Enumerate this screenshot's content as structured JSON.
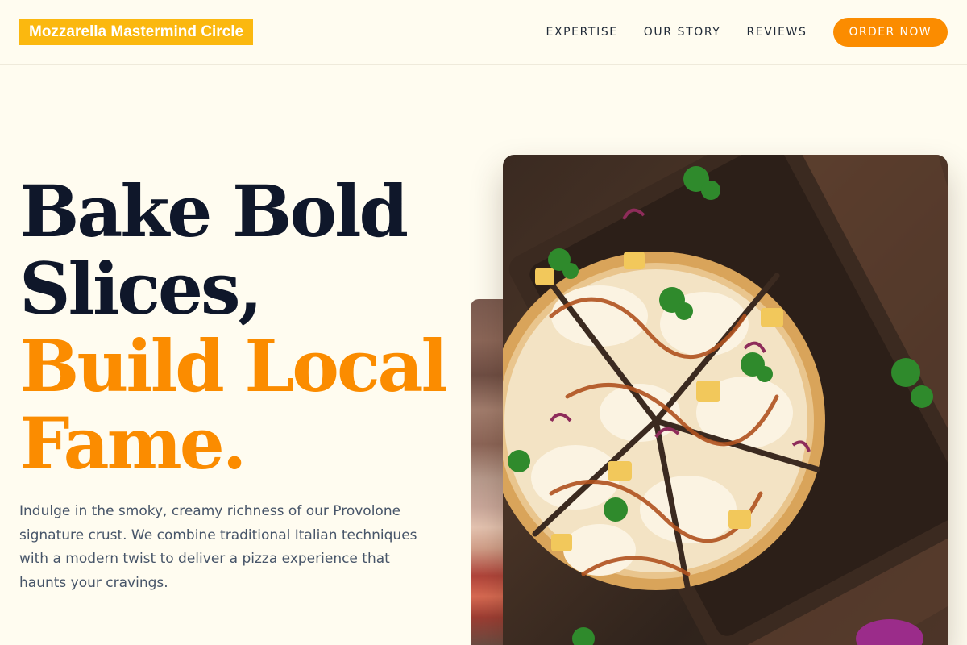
{
  "brand": {
    "name": "Mozzarella Mastermind Circle"
  },
  "nav": {
    "links": [
      "EXPERTISE",
      "OUR STORY",
      "REVIEWS"
    ],
    "cta": "ORDER NOW"
  },
  "hero": {
    "headline_dark": [
      "Bake Bold",
      "Slices,"
    ],
    "headline_accent": [
      "Build Local",
      "Fame."
    ],
    "description": "Indulge in the smoky, creamy richness of our Provolone signature crust. We combine traditional Italian techniques with a modern twist to deliver a pizza experience that haunts your cravings."
  },
  "colors": {
    "background": "#fffcf0",
    "brand_badge": "#fbb80f",
    "accent": "#fb8c00",
    "headline": "#0f172a",
    "body_text": "#475569"
  }
}
